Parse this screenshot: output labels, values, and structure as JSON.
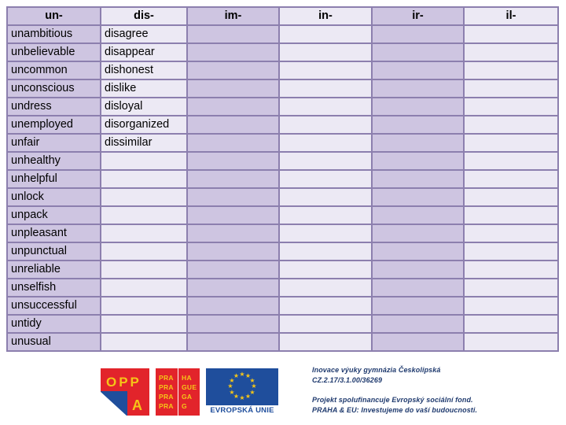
{
  "document": {
    "title": "Negative prefixes worksheet table"
  },
  "table": {
    "columns": [
      {
        "header": "un-",
        "tint": "A"
      },
      {
        "header": "dis-",
        "tint": "B"
      },
      {
        "header": "im-",
        "tint": "A"
      },
      {
        "header": "in-",
        "tint": "B"
      },
      {
        "header": "ir-",
        "tint": "A"
      },
      {
        "header": "il-",
        "tint": "B"
      }
    ],
    "row_count": 17,
    "rows": [
      [
        "unambitious",
        "disagree",
        "",
        "",
        "",
        ""
      ],
      [
        "unbelievable",
        "disappear",
        "",
        "",
        "",
        ""
      ],
      [
        "uncommon",
        "dishonest",
        "",
        "",
        "",
        ""
      ],
      [
        "unconscious",
        "dislike",
        "",
        "",
        "",
        ""
      ],
      [
        "undress",
        "disloyal",
        "",
        "",
        "",
        ""
      ],
      [
        "unemployed",
        "disorganized",
        "",
        "",
        "",
        ""
      ],
      [
        "unfair",
        "dissimilar",
        "",
        "",
        "",
        ""
      ],
      [
        "unhealthy",
        "",
        "",
        "",
        "",
        ""
      ],
      [
        "unhelpful",
        "",
        "",
        "",
        "",
        ""
      ],
      [
        "unlock",
        "",
        "",
        "",
        "",
        ""
      ],
      [
        "unpack",
        "",
        "",
        "",
        "",
        ""
      ],
      [
        "unpleasant",
        "",
        "",
        "",
        "",
        ""
      ],
      [
        "unpunctual",
        "",
        "",
        "",
        "",
        ""
      ],
      [
        "unreliable",
        "",
        "",
        "",
        "",
        ""
      ],
      [
        "unselfish",
        "",
        "",
        "",
        "",
        ""
      ],
      [
        "unsuccessful",
        "",
        "",
        "",
        "",
        ""
      ],
      [
        "untidy",
        "",
        "",
        "",
        "",
        ""
      ],
      [
        "unusual",
        "",
        "",
        "",
        "",
        ""
      ]
    ]
  },
  "footer": {
    "logos": {
      "oppa": {
        "top_text": "OPP",
        "bottom_text": "A"
      },
      "praha": {
        "left_lines": [
          "PRA",
          "PRA",
          "PRA",
          "PRA"
        ],
        "right_lines": [
          "HA",
          "GUE",
          "GA",
          "G"
        ]
      },
      "eu": {
        "caption": "EVROPSKÁ UNIE",
        "star_count": 12
      }
    },
    "project_text": {
      "line1": "Inovace výuky gymnázia Českolipská",
      "line2": "CZ.2.17/3.1.00/36269",
      "line3": "Projekt spolufinancuje Evropský sociální fond.",
      "line4": "PRAHA & EU: Investujeme do vaší budoucnosti."
    }
  },
  "colors": {
    "border": "#8c7fae",
    "column_tint_a": "#cec5e1",
    "column_tint_b": "#ece9f4",
    "logo_red": "#e2242b",
    "logo_yellow": "#f5c518",
    "logo_blue": "#1f4e9c",
    "project_text": "#1f3a6e"
  }
}
